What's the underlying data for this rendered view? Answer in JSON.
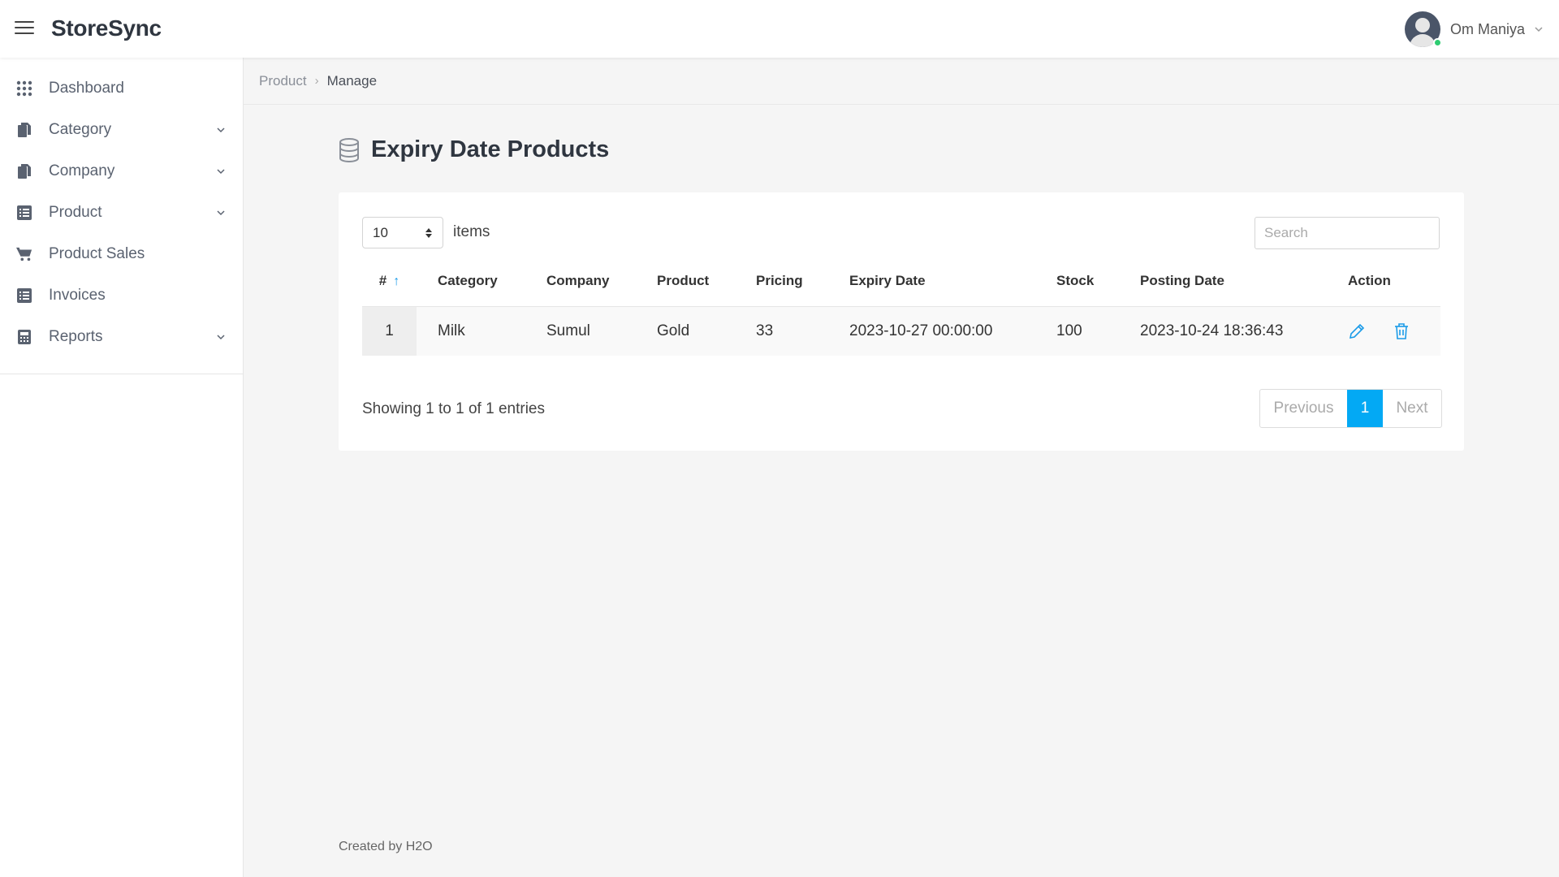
{
  "header": {
    "app_name": "StoreSync",
    "user_name": "Om Maniya"
  },
  "sidebar": {
    "items": [
      {
        "label": "Dashboard",
        "icon": "grid-icon",
        "has_submenu": false
      },
      {
        "label": "Category",
        "icon": "files-icon",
        "has_submenu": true
      },
      {
        "label": "Company",
        "icon": "files-icon",
        "has_submenu": true
      },
      {
        "label": "Product",
        "icon": "list-icon",
        "has_submenu": true
      },
      {
        "label": "Product Sales",
        "icon": "cart-icon",
        "has_submenu": false
      },
      {
        "label": "Invoices",
        "icon": "list-icon",
        "has_submenu": false
      },
      {
        "label": "Reports",
        "icon": "calculator-icon",
        "has_submenu": true
      }
    ]
  },
  "breadcrumb": {
    "parent": "Product",
    "current": "Manage"
  },
  "page": {
    "title": "Expiry Date Products"
  },
  "table_controls": {
    "page_length": "10",
    "items_label": "items",
    "search_placeholder": "Search"
  },
  "table": {
    "columns": [
      "#",
      "Category",
      "Company",
      "Product",
      "Pricing",
      "Expiry Date",
      "Stock",
      "Posting Date",
      "Action"
    ],
    "rows": [
      {
        "num": "1",
        "category": "Milk",
        "company": "Sumul",
        "product": "Gold",
        "pricing": "33",
        "expiry_date": "2023-10-27 00:00:00",
        "stock": "100",
        "posting_date": "2023-10-24 18:36:43"
      }
    ]
  },
  "pagination": {
    "info": "Showing 1 to 1 of 1 entries",
    "previous": "Previous",
    "current_page": "1",
    "next": "Next"
  },
  "footer": {
    "prefix": "Created by ",
    "author": "H2O"
  },
  "colors": {
    "accent": "#03a9f4",
    "sort_arrow": "#1a9be8",
    "online": "#2ecc71"
  }
}
